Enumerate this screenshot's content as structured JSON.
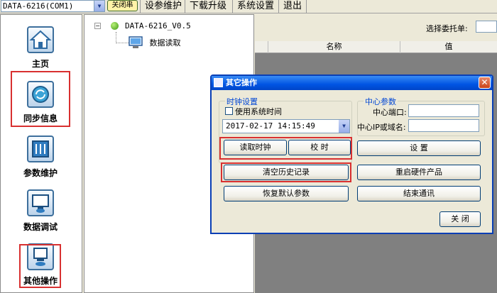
{
  "toolbar": {
    "port_select": "DATA-6216(COM1)",
    "close_serial": "关闭串",
    "menu": [
      "设参维护",
      "下载升级",
      "系统设置",
      "退出"
    ]
  },
  "nav": [
    {
      "label": "主页",
      "icon": "home-icon"
    },
    {
      "label": "同步信息",
      "icon": "sync-icon"
    },
    {
      "label": "参数维护",
      "icon": "settings-panel-icon"
    },
    {
      "label": "数据调试",
      "icon": "monitor-icon"
    },
    {
      "label": "其他操作",
      "icon": "device-icon"
    }
  ],
  "tree": {
    "root": "DATA-6216_V0.5",
    "child": "数据读取"
  },
  "right": {
    "choose_label": "选择委托单:",
    "columns": [
      "名称",
      "值"
    ]
  },
  "dialog": {
    "title": "其它操作",
    "clock_group": "时钟设置",
    "use_system_time": "使用系统时间",
    "datetime": "2017-02-17 14:15:49",
    "read_clock": "读取时钟",
    "calibrate": "校  时",
    "center_group": "中心参数",
    "center_port": "中心端口:",
    "center_ip": "中心IP或域名:",
    "set": "设  置",
    "clear_history": "清空历史记录",
    "restart_hw": "重启硬件产品",
    "restore_defaults": "恢复默认参数",
    "end_comm": "结束通讯",
    "close": "关  闭"
  },
  "colors": {
    "highlight": "#d83030",
    "title_bar": "#0054e3",
    "group_title": "#0046d5"
  }
}
